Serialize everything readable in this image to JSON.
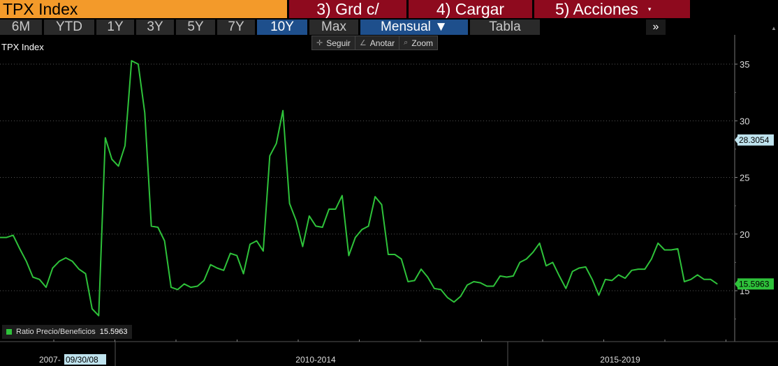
{
  "topbar": {
    "title": "TPX Index",
    "btn_grd": "3) Grd c/",
    "btn_cargar": "4) Cargar",
    "btn_acciones": "5) Acciones",
    "acciones_caret": "▾"
  },
  "periods": {
    "items": [
      "6M",
      "YTD",
      "1Y",
      "3Y",
      "5Y",
      "7Y",
      "10Y",
      "Max",
      "Mensual ▼",
      "Tabla"
    ],
    "active": "10Y",
    "more": "»"
  },
  "tools": {
    "seguir": "Seguir",
    "anotar": "Anotar",
    "zoom": "Zoom"
  },
  "chart_title": "TPX Index",
  "legend": {
    "label": "Ratio Precio/Beneficios",
    "value": "15.5963",
    "color": "#2ec23a"
  },
  "chart_data": {
    "type": "line",
    "title": "TPX Index",
    "series": [
      {
        "name": "Ratio Precio/Beneficios",
        "color": "#2ec23a",
        "values": [
          19.7,
          19.7,
          19.9,
          18.7,
          17.6,
          16.2,
          16.0,
          15.3,
          17.0,
          17.6,
          17.9,
          17.6,
          16.9,
          16.5,
          13.4,
          12.8,
          28.5,
          26.6,
          26.0,
          27.8,
          35.3,
          35.0,
          30.7,
          20.7,
          20.6,
          19.4,
          15.3,
          15.1,
          15.6,
          15.3,
          15.4,
          15.9,
          17.3,
          17.0,
          16.8,
          18.3,
          18.1,
          16.5,
          19.1,
          19.4,
          18.5,
          26.9,
          28.0,
          30.9,
          22.7,
          21.2,
          18.9,
          21.6,
          20.7,
          20.6,
          22.2,
          22.2,
          23.4,
          18.1,
          19.7,
          20.4,
          20.7,
          23.3,
          22.6,
          18.2,
          18.2,
          17.8,
          15.8,
          15.9,
          16.9,
          16.2,
          15.2,
          15.1,
          14.4,
          14.0,
          14.5,
          15.5,
          15.8,
          15.7,
          15.4,
          15.4,
          16.3,
          16.2,
          16.3,
          17.5,
          17.8,
          18.4,
          19.2,
          17.2,
          17.5,
          16.3,
          15.2,
          16.7,
          17.0,
          17.1,
          16.0,
          14.6,
          16.0,
          15.9,
          16.4,
          16.1,
          16.8,
          16.9,
          16.9,
          17.8,
          19.2,
          18.6,
          18.6,
          18.7,
          15.8,
          16.0,
          16.4,
          16.0,
          16.0,
          15.6
        ]
      }
    ],
    "ylim": [
      11.0,
      37.0
    ],
    "y_ticks": [
      "15",
      "20",
      "25",
      "30",
      "35"
    ],
    "y_tick_values": [
      15,
      20,
      25,
      30,
      35
    ],
    "x_labels": [
      "2007-",
      "2010-2014",
      "2015-2019"
    ],
    "x_date_label": "09/30/08",
    "markers": [
      {
        "label": "28.3054",
        "value": 28.3054,
        "bg": "#bfe3ee",
        "fg": "#000"
      },
      {
        "label": "15.5963",
        "value": 15.5963,
        "bg": "#2ec23a",
        "fg": "#000"
      }
    ],
    "grid": "horizontal-dotted",
    "legend_position": "bottom-left"
  }
}
